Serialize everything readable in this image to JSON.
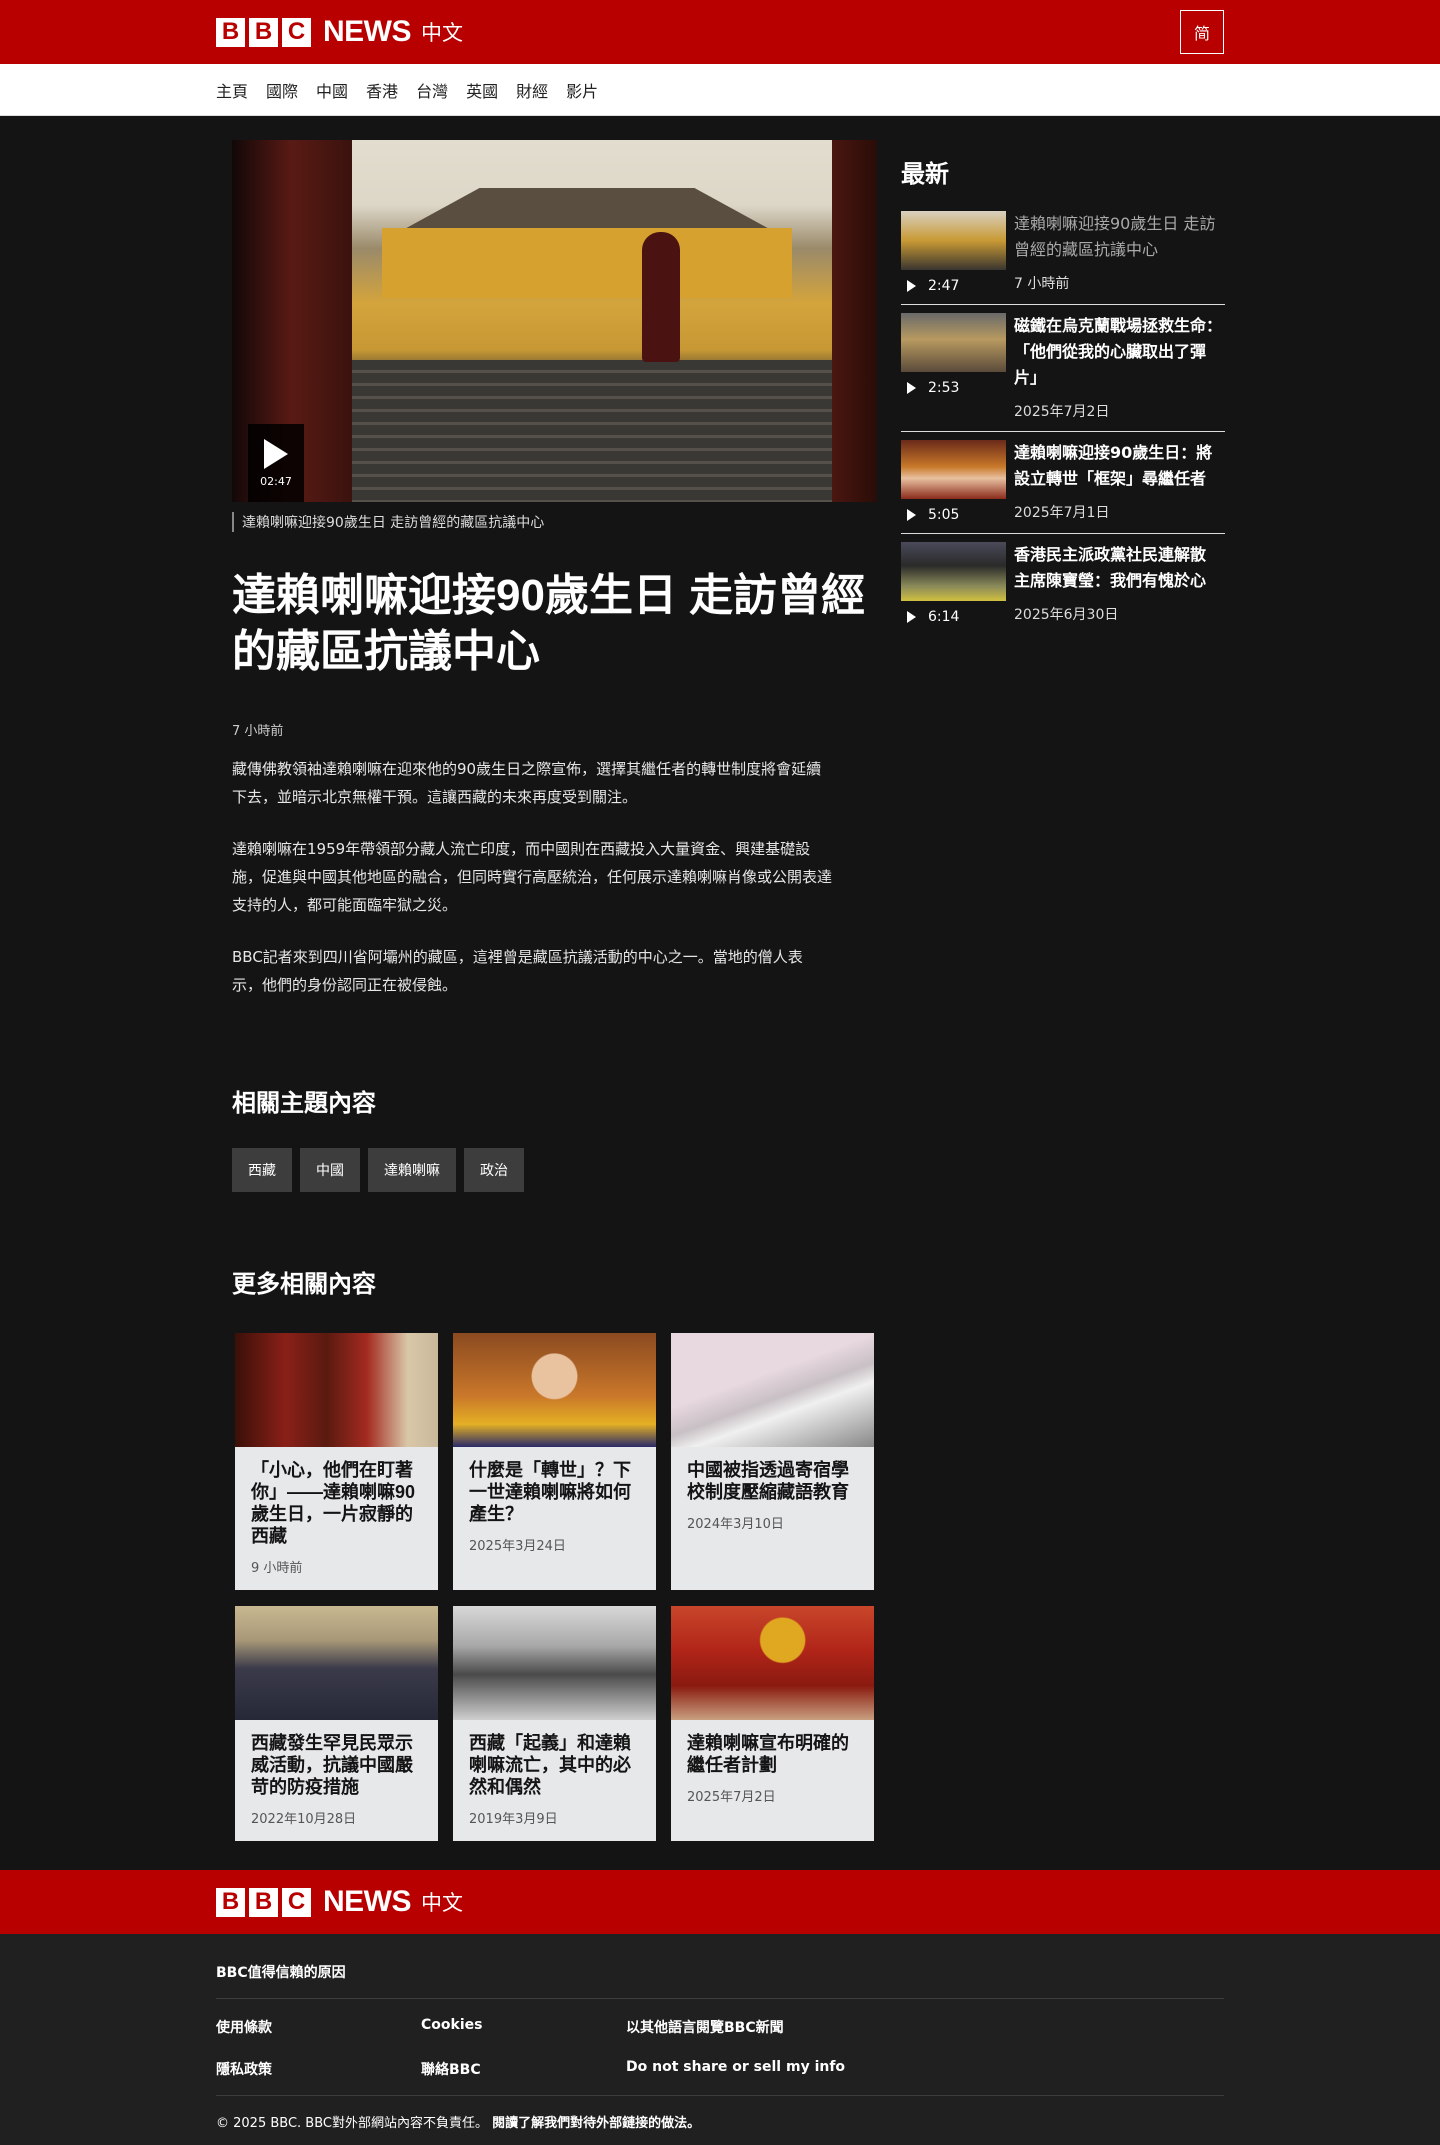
{
  "header": {
    "brand_blocks": [
      "B",
      "B",
      "C"
    ],
    "brand_word": "NEWS",
    "brand_lang": "中文",
    "lang_toggle": "简"
  },
  "nav": {
    "items": [
      "主頁",
      "國際",
      "中國",
      "香港",
      "台灣",
      "英國",
      "財經",
      "影片"
    ]
  },
  "video": {
    "duration": "02:47",
    "caption": "達賴喇嘛迎接90歲生日 走訪曾經的藏區抗議中心"
  },
  "article": {
    "headline": "達賴喇嘛迎接90歲生日 走訪曾經的藏區抗議中心",
    "timestamp": "7 小時前",
    "paragraphs": [
      "藏傳佛教領袖達賴喇嘛在迎來他的90歲生日之際宣佈，選擇其繼任者的轉世制度將會延續下去，並暗示北京無權干預。這讓西藏的未來再度受到關注。",
      "達賴喇嘛在1959年帶領部分藏人流亡印度，而中國則在西藏投入大量資金、興建基礎設施，促進與中國其他地區的融合，但同時實行高壓統治，任何展示達賴喇嘛肖像或公開表達支持的人，都可能面臨牢獄之災。",
      "BBC記者來到四川省阿壩州的藏區，這裡曾是藏區抗議活動的中心之一。當地的僧人表示，他們的身份認同正在被侵蝕。"
    ]
  },
  "topics": {
    "title": "相關主題內容",
    "tags": [
      "西藏",
      "中國",
      "達賴喇嘛",
      "政治"
    ]
  },
  "more": {
    "title": "更多相關內容",
    "cards": [
      {
        "title": "「小心，他們在盯著你」——達賴喇嘛90歲生日，一片寂靜的西藏",
        "date": "9 小時前"
      },
      {
        "title": "什麼是「轉世」？下一世達賴喇嘛將如何產生？",
        "date": "2025年3月24日"
      },
      {
        "title": "中國被指透過寄宿學校制度壓縮藏語教育",
        "date": "2024年3月10日"
      },
      {
        "title": "西藏發生罕見民眾示威活動，抗議中國嚴苛的防疫措施",
        "date": "2022年10月28日"
      },
      {
        "title": "西藏「起義」和達賴喇嘛流亡，其中的必然和偶然",
        "date": "2019年3月9日"
      },
      {
        "title": "達賴喇嘛宣布明確的繼任者計劃",
        "date": "2025年7月2日"
      }
    ]
  },
  "sidebar": {
    "title": "最新",
    "items": [
      {
        "duration": "2:47",
        "headline": "達賴喇嘛迎接90歲生日 走訪曾經的藏區抗議中心",
        "date": "7 小時前"
      },
      {
        "duration": "2:53",
        "headline": "磁鐵在烏克蘭戰場拯救生命：「他們從我的心臟取出了彈片」",
        "date": "2025年7月2日"
      },
      {
        "duration": "5:05",
        "headline": "達賴喇嘛迎接90歲生日：將設立轉世「框架」尋繼任者",
        "date": "2025年7月1日"
      },
      {
        "duration": "6:14",
        "headline": "香港民主派政黨社民連解散 主席陳寶瑩：我們有愧於心",
        "date": "2025年6月30日"
      }
    ]
  },
  "footer": {
    "trust": "BBC值得信賴的原因",
    "links": [
      "使用條款",
      "Cookies",
      "以其他語言閱覽BBC新聞",
      "隱私政策",
      "聯絡BBC",
      "Do not share or sell my info"
    ],
    "copyright": "© 2025 BBC. BBC對外部網站內容不負責任。",
    "external_link": "閱讀了解我們對待外部鏈接的做法。"
  },
  "colors": {
    "brand_red": "#b80000",
    "page_bg": "#141414",
    "card_bg": "#e6e8ea",
    "tag_bg": "#3d3d3d"
  }
}
